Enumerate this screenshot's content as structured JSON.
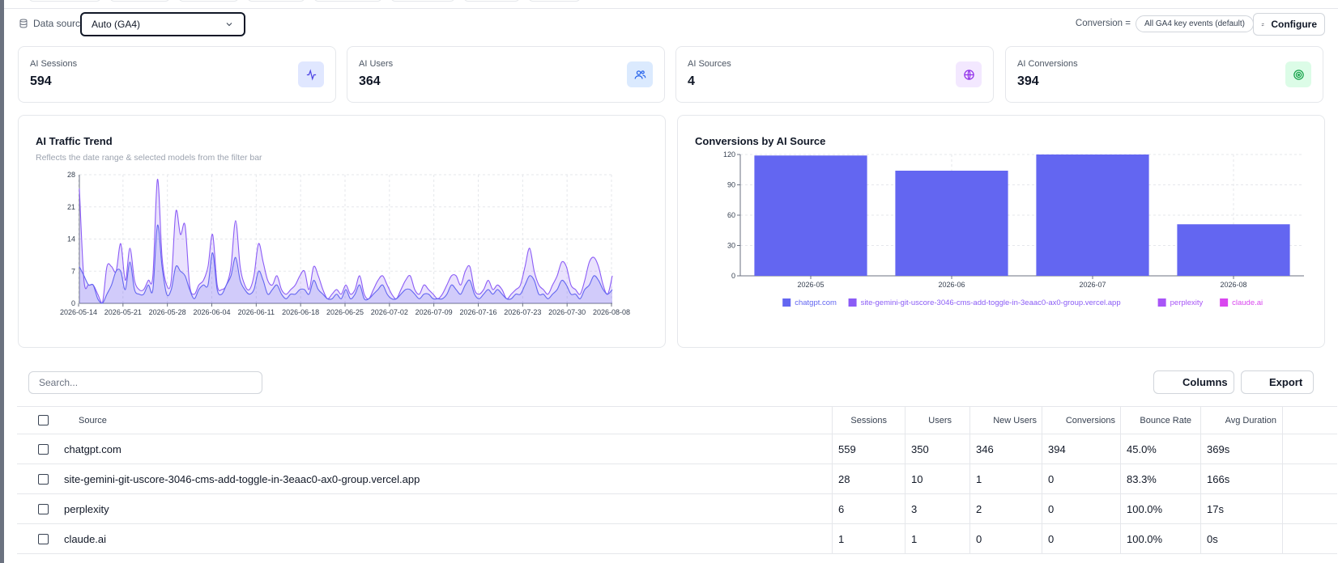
{
  "filters": {
    "data_source_label": "Data source",
    "data_source_value": "Auto (GA4)",
    "conversion_label": "Conversion =",
    "conversion_value": "All GA4 key events (default)",
    "configure_label": "Configure"
  },
  "metrics": [
    {
      "label": "AI Sessions",
      "value": "594",
      "icon": "activity-icon",
      "color": "#4f46e5",
      "bg": "#e0e7ff"
    },
    {
      "label": "AI Users",
      "value": "364",
      "icon": "users-icon",
      "color": "#2563eb",
      "bg": "#dbeafe"
    },
    {
      "label": "AI Sources",
      "value": "4",
      "icon": "globe-icon",
      "color": "#9333ea",
      "bg": "#f3e8ff"
    },
    {
      "label": "AI Conversions",
      "value": "394",
      "icon": "target-icon",
      "color": "#16a34a",
      "bg": "#dcfce7"
    }
  ],
  "trend": {
    "title": "AI Traffic Trend",
    "subtitle": "Reflects the date range & selected models from the filter bar"
  },
  "conversions": {
    "title": "Conversions by AI Source"
  },
  "chart_data": [
    {
      "type": "area",
      "title": "AI Traffic Trend",
      "ylim": [
        0,
        28
      ],
      "yticks": [
        0,
        7,
        14,
        21,
        28
      ],
      "xticks": [
        "2026-05-14",
        "2026-05-21",
        "2026-05-28",
        "2026-06-04",
        "2026-06-11",
        "2026-06-18",
        "2026-06-25",
        "2026-07-02",
        "2026-07-09",
        "2026-07-16",
        "2026-07-23",
        "2026-07-30",
        "2026-08-08"
      ],
      "series": [
        {
          "values": [
            25,
            5,
            4,
            4,
            2,
            0,
            8,
            8,
            7,
            13,
            5,
            12,
            5,
            3,
            3,
            5,
            6,
            27,
            10,
            4,
            5,
            20,
            15,
            17,
            4,
            2,
            4,
            5,
            8,
            15,
            4,
            3,
            4,
            8,
            18,
            8,
            4,
            3,
            6,
            13,
            9,
            5,
            4,
            6,
            3,
            2,
            3,
            4,
            6,
            7,
            3,
            8,
            6,
            3,
            1,
            2,
            3,
            2,
            4,
            2,
            3,
            6,
            2,
            1,
            3,
            5,
            6,
            4,
            2,
            1,
            3,
            5,
            6,
            3,
            2,
            4,
            3,
            2,
            1,
            2,
            4,
            6,
            6,
            4,
            7,
            8,
            3,
            2,
            3,
            5,
            3,
            4,
            3,
            1,
            2,
            3,
            4,
            8,
            12,
            7,
            4,
            3,
            2,
            4,
            6,
            9,
            8,
            4,
            3,
            2,
            5,
            9,
            10,
            8,
            4,
            2,
            6
          ],
          "color": "#8b5cf6"
        },
        {
          "values": [
            8,
            6,
            4,
            4,
            1,
            0,
            2,
            4,
            7,
            7,
            3,
            9,
            3,
            2,
            2,
            4,
            3,
            17,
            8,
            2,
            3,
            8,
            7,
            6,
            3,
            1,
            3,
            4,
            4,
            11,
            3,
            2,
            4,
            6,
            10,
            5,
            3,
            2,
            3,
            7,
            5,
            2,
            3,
            4,
            2,
            1,
            2,
            2,
            3,
            3,
            2,
            5,
            3,
            2,
            1,
            1,
            2,
            1,
            3,
            1,
            2,
            4,
            1,
            1,
            2,
            3,
            4,
            2,
            1,
            1,
            2,
            3,
            3,
            2,
            1,
            2,
            2,
            1,
            1,
            1,
            2,
            4,
            3,
            2,
            4,
            5,
            2,
            1,
            2,
            3,
            2,
            3,
            2,
            1,
            1,
            2,
            2,
            4,
            6,
            5,
            2,
            2,
            1,
            2,
            3,
            5,
            4,
            2,
            2,
            1,
            3,
            4,
            6,
            5,
            3,
            2,
            3
          ],
          "color": "#6366f1"
        }
      ]
    },
    {
      "type": "bar",
      "title": "Conversions by AI Source",
      "categories": [
        "2026-05",
        "2026-06",
        "2026-07",
        "2026-08"
      ],
      "ylim": [
        0,
        120
      ],
      "yticks": [
        0,
        30,
        60,
        90,
        120
      ],
      "series": [
        {
          "name": "chatgpt.com",
          "values": [
            119,
            104,
            120,
            51
          ],
          "color": "#6366f1"
        },
        {
          "name": "site-gemini-git-uscore-3046-cms-add-toggle-in-3eaac0-ax0-group.vercel.app",
          "values": [
            0,
            0,
            0,
            0
          ],
          "color": "#8b5cf6"
        },
        {
          "name": "perplexity",
          "values": [
            0,
            0,
            0,
            0
          ],
          "color": "#a855f7"
        },
        {
          "name": "claude.ai",
          "values": [
            0,
            0,
            0,
            0
          ],
          "color": "#d946ef"
        }
      ]
    }
  ],
  "table": {
    "search_placeholder": "Search...",
    "columns_label": "Columns",
    "export_label": "Export",
    "headers": {
      "source": "Source",
      "sessions": "Sessions",
      "users": "Users",
      "new_users": "New Users",
      "conversions": "Conversions",
      "bounce_rate": "Bounce Rate",
      "avg_duration": "Avg Duration"
    },
    "rows": [
      {
        "source": "chatgpt.com",
        "sessions": "559",
        "users": "350",
        "new_users": "346",
        "conversions": "394",
        "bounce_rate": "45.0%",
        "avg_duration": "369s"
      },
      {
        "source": "site-gemini-git-uscore-3046-cms-add-toggle-in-3eaac0-ax0-group.vercel.app",
        "sessions": "28",
        "users": "10",
        "new_users": "1",
        "conversions": "0",
        "bounce_rate": "83.3%",
        "avg_duration": "166s"
      },
      {
        "source": "perplexity",
        "sessions": "6",
        "users": "3",
        "new_users": "2",
        "conversions": "0",
        "bounce_rate": "100.0%",
        "avg_duration": "17s"
      },
      {
        "source": "claude.ai",
        "sessions": "1",
        "users": "1",
        "new_users": "0",
        "conversions": "0",
        "bounce_rate": "100.0%",
        "avg_duration": "0s"
      }
    ]
  }
}
